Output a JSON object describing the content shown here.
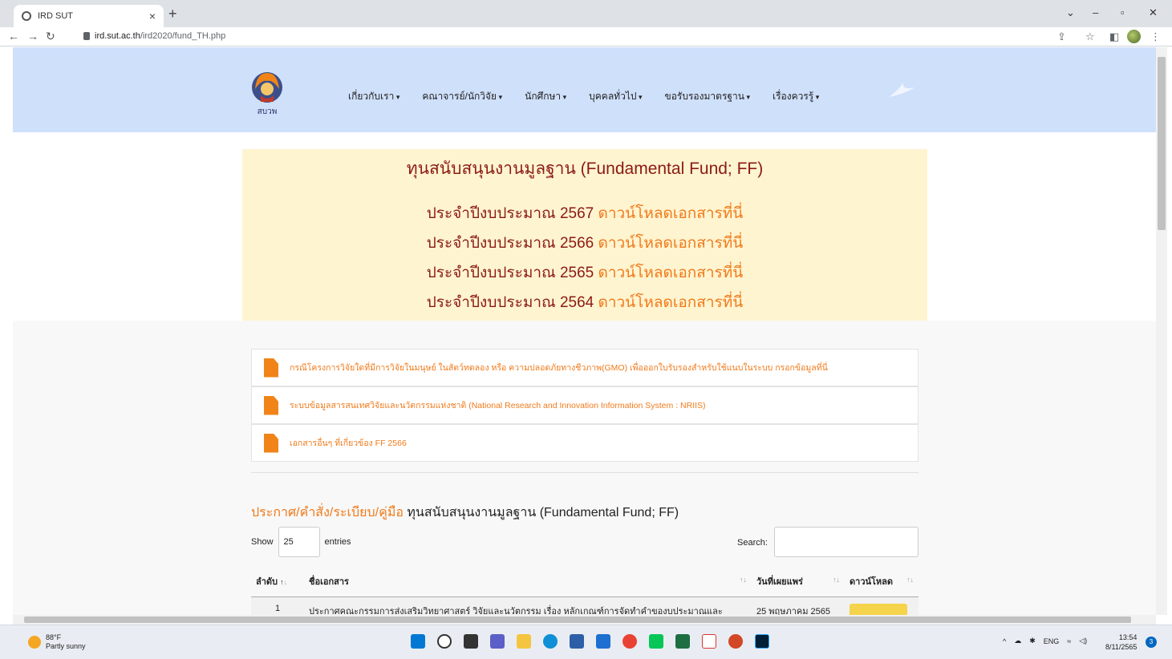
{
  "browser": {
    "tab_title": "IRD SUT",
    "tab_close": "×",
    "new_tab": "+",
    "url_host": "ird.sut.ac.th",
    "url_path": "/ird2020/fund_TH.php"
  },
  "header": {
    "logo_text": "สบวพ",
    "menu": [
      "เกี่ยวกับเรา",
      "คณาจารย์/นักวิจัย",
      "นักศึกษา",
      "บุคคลทั่วไป",
      "ขอรับรองมาตรฐาน",
      "เรื่องควรรู้"
    ]
  },
  "hero": {
    "title": "ทุนสนับสนุนงานมูลฐาน (Fundamental Fund; FF)",
    "rows": [
      {
        "label": "ประจำปีงบประมาณ 2567",
        "link": "ดาวน์โหลดเอกสารที่นี่"
      },
      {
        "label": "ประจำปีงบประมาณ 2566",
        "link": "ดาวน์โหลดเอกสารที่นี่"
      },
      {
        "label": "ประจำปีงบประมาณ 2565",
        "link": "ดาวน์โหลดเอกสารที่นี่"
      },
      {
        "label": "ประจำปีงบประมาณ 2564",
        "link": "ดาวน์โหลดเอกสารที่นี่"
      }
    ]
  },
  "cards": [
    "กรณีโครงการวิจัยใดที่มีการวิจัยในมนุษย์ ในสัตว์ทดลอง หรือ ความปลอดภัยทางชีวภาพ(GMO) เพื่อออกใบรับรองสำหรับใช้แนบในระบบ กรอกข้อมูลที่นี่",
    "ระบบข้อมูลสารสนเทศวิจัยและนวัตกรรมแห่งชาติ (National Research and Innovation Information System : NRIIS)",
    "เอกสารอื่นๆ ที่เกี่ยวข้อง FF 2566"
  ],
  "section": {
    "title_orange": "ประกาศ/คำสั่ง/ระเบียบ/คู่มือ",
    "title_rest": " ทุนสนับสนุนงานมูลฐาน (Fundamental Fund; FF)",
    "show_label": "Show",
    "show_value": "25",
    "entries_label": "entries",
    "search_label": "Search:"
  },
  "table": {
    "headers": [
      "ลำดับ",
      "ชื่อเอกสาร",
      "วันที่เผยแพร่",
      "ดาวน์โหลด"
    ],
    "row1": {
      "no": "1",
      "name": "ประกาศคณะกรรมการส่งเสริมวิทยาศาสตร์ วิจัยและนวัตกรรม เรื่อง หลักเกณฑ์การจัดทำคำของบประมาณและ",
      "date": "25 พฤษภาคม 2565"
    }
  },
  "taskbar": {
    "temp": "88°F",
    "weather": "Partly sunny",
    "lang": "ENG",
    "time": "13:54",
    "date": "8/11/2565",
    "notif_count": "3"
  },
  "colors": {
    "header_bg": "#cfe0fb",
    "hero_bg": "#fff4d0",
    "title_red": "#8b1a12",
    "accent_orange": "#f07a1a"
  }
}
